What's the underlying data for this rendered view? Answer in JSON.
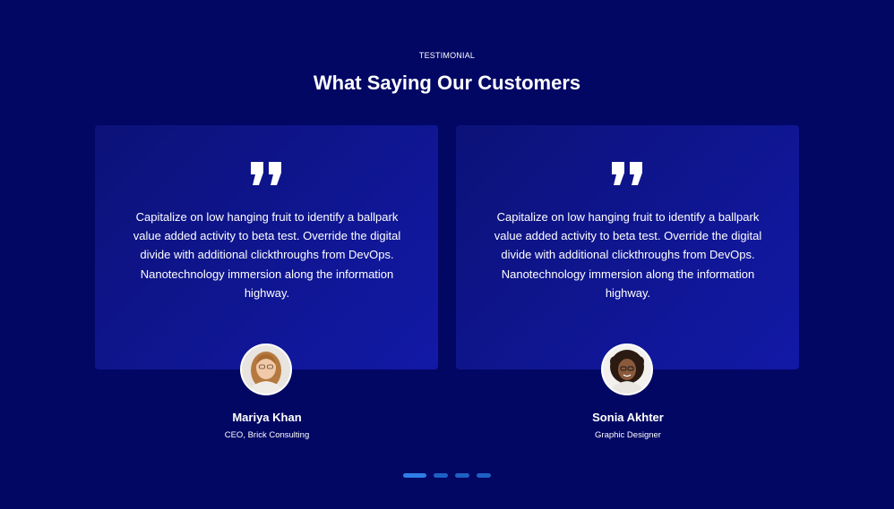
{
  "section": {
    "eyebrow": "TESTIMONIAL",
    "headline": "What Saying Our Customers"
  },
  "testimonials": [
    {
      "quote": "Capitalize on low hanging fruit to identify a ballpark value added activity to beta test. Override the digital divide with additional clickthroughs from DevOps. Nanotechnology immersion along the information highway.",
      "name": "Mariya Khan",
      "role": "CEO, Brick Consulting"
    },
    {
      "quote": "Capitalize on low hanging fruit to identify a ballpark value added activity to beta test. Override the digital divide with additional clickthroughs from DevOps. Nanotechnology immersion along the information highway.",
      "name": "Sonia Akhter",
      "role": "Graphic Designer"
    }
  ],
  "pagination": {
    "total": 4,
    "active_index": 0
  },
  "colors": {
    "background": "#020764",
    "card_start": "#0c1278",
    "card_end": "#1219a6",
    "dot": "#1e5fc4",
    "dot_active": "#2d7ee6"
  },
  "icons": {
    "quote": "quote-icon"
  }
}
